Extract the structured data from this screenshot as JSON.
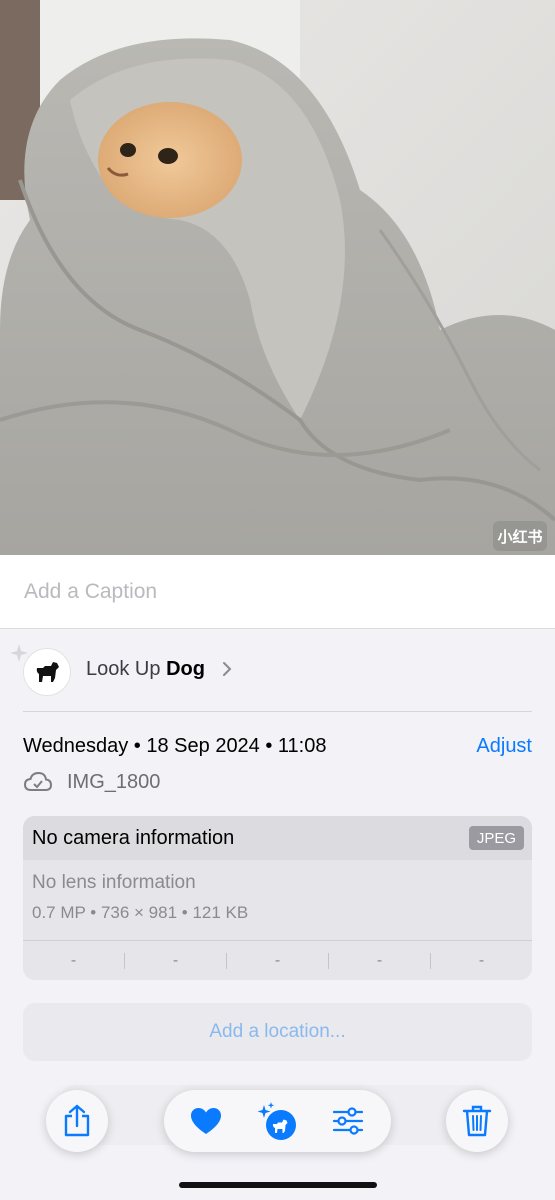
{
  "photo": {
    "watermark": "小红书"
  },
  "caption": {
    "placeholder": "Add a Caption"
  },
  "lookup": {
    "prefix": "Look Up",
    "subject": "Dog"
  },
  "info": {
    "date": "Wednesday • 18 Sep 2024 • 11:08",
    "adjust_label": "Adjust",
    "filename": "IMG_1800"
  },
  "camera": {
    "title": "No camera information",
    "format": "JPEG",
    "lens": "No lens information",
    "details": "0.7 MP  •  736 × 981  •  121 KB",
    "stats": [
      "-",
      "-",
      "-",
      "-",
      "-"
    ]
  },
  "location": {
    "label": "Add a location..."
  },
  "colors": {
    "accent": "#0a7aff",
    "background": "#f2f2f7"
  },
  "toolbar": {
    "icons": [
      "share-icon",
      "favorite-heart-icon",
      "visual-lookup-icon",
      "adjust-sliders-icon",
      "trash-icon"
    ]
  }
}
